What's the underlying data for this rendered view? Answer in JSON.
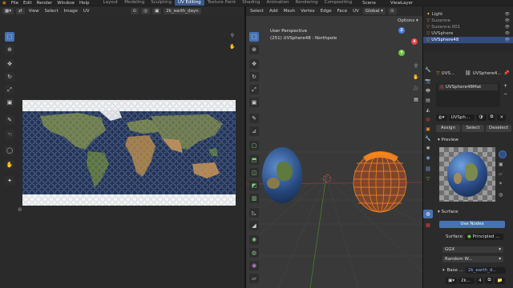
{
  "topbar": {
    "menus": [
      "File",
      "Edit",
      "Render",
      "Window",
      "Help"
    ],
    "workspaces": [
      "Layout",
      "Modeling",
      "Sculpting",
      "UV Editing",
      "Texture Paint",
      "Shading",
      "Animation",
      "Rendering",
      "Compositing"
    ],
    "active_workspace": "UV Editing",
    "scene_label": "Scene",
    "viewlayer_label": "ViewLayer"
  },
  "uv_editor": {
    "menus": [
      "View",
      "Select",
      "Image",
      "UV"
    ],
    "image_name": "2k_earth_dayn",
    "tools": [
      "select-box",
      "cursor",
      "move",
      "rotate",
      "scale",
      "transform",
      "annotate",
      "grab",
      "relax",
      "pinch",
      "sample"
    ]
  },
  "viewport": {
    "menus": [
      "Select",
      "Add",
      "Mesh",
      "Vertex",
      "Edge",
      "Face",
      "UV"
    ],
    "orientation": "Global",
    "options_label": "Options",
    "info_line1": "User Perspective",
    "info_line2": "(251) UVSphere48 : Northpole",
    "axes": [
      "X",
      "Y",
      "Z"
    ],
    "tools": [
      "select",
      "cursor",
      "move",
      "rotate",
      "scale",
      "transform",
      "annotate",
      "measure",
      "add-cube",
      "extrude",
      "inset",
      "bevel",
      "loop-cut",
      "knife",
      "poly-build",
      "spin",
      "smooth",
      "shrink",
      "shear",
      "rip"
    ]
  },
  "outliner": {
    "rows": [
      {
        "name": "Light",
        "selected": false
      },
      {
        "name": "Suzanne",
        "selected": false
      },
      {
        "name": "Suzanne.001",
        "selected": false
      },
      {
        "name": "UVSphere",
        "selected": false
      },
      {
        "name": "UVSphere48",
        "selected": true
      }
    ]
  },
  "properties": {
    "object_name": "UVS...",
    "mesh_label": "UVSphere4...",
    "material_slot": "UVSphere48Mat",
    "material_field": "UVSph...",
    "assign_label": "Assign",
    "select_label": "Select",
    "deselect_label": "Deselect",
    "preview_header": "Preview",
    "surface_header": "Surface",
    "use_nodes_label": "Use Nodes",
    "surface_label": "Surface",
    "surface_value": "Principled ...",
    "distribution_value": "GGX",
    "subsurface_value": "Random W...",
    "base_color_label": "Base ...",
    "base_color_value": "2k_earth_d...",
    "texture_field": "2k...",
    "texture_users": "4"
  },
  "colors": {
    "accent": "#4772b3",
    "selection_orange": "#ff8a1c",
    "axis_x": "#e0464a",
    "axis_y": "#6ac33f",
    "axis_z": "#4a7fe0"
  }
}
